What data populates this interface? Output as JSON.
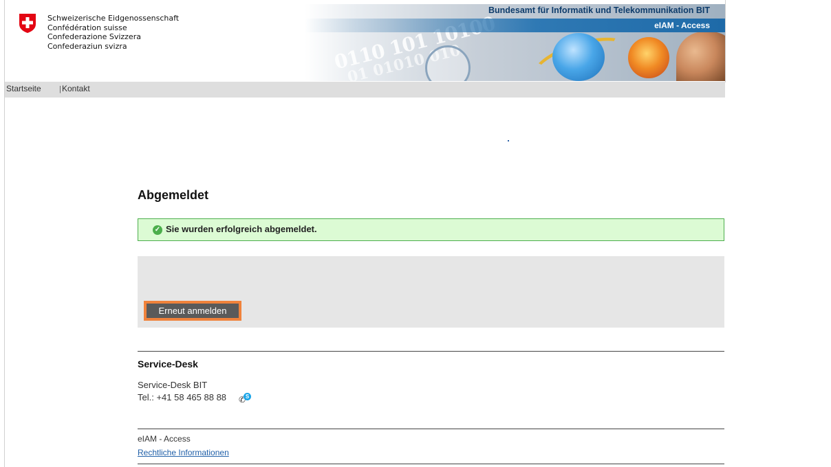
{
  "header": {
    "confederation_lines": [
      "Schweizerische Eidgenossenschaft",
      "Confédération suisse",
      "Confederazione Svizzera",
      "Confederaziun svizra"
    ],
    "agency": "Bundesamt für Informatik und Telekommunikation BIT",
    "app_name": "eIAM - Access"
  },
  "nav": {
    "items": [
      {
        "label": "Startseite"
      },
      {
        "label": "Kontakt"
      }
    ],
    "separator": "|"
  },
  "main": {
    "title": "Abgemeldet",
    "success_message": "Sie wurden erfolgreich abgemeldet.",
    "relogin_button": "Erneut anmelden"
  },
  "service_desk": {
    "heading": "Service-Desk",
    "name": "Service-Desk BIT",
    "phone": "Tel.: +41 58 465 88 88"
  },
  "footer": {
    "brand": "eIAM - Access",
    "legal_link": "Rechtliche Informationen"
  },
  "colors": {
    "success_bg": "#dcfbd4",
    "success_border": "#4cae4c",
    "button_bg": "#5a5a5a",
    "button_highlight": "#f0823b",
    "nav_bg": "#dedede",
    "link": "#1f5fa8"
  },
  "icons": {
    "logo": "swiss-cross-icon",
    "success": "check-circle-icon",
    "phone": "phone-icon",
    "skype": "skype-icon"
  }
}
